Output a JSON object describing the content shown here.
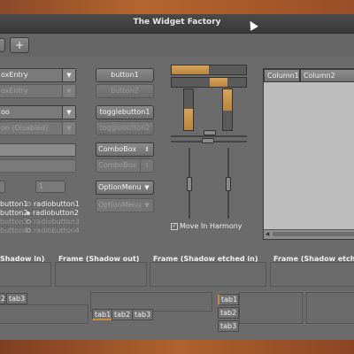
{
  "window": {
    "title": "The Widget Factory"
  },
  "toolbar": {
    "add_label": "+"
  },
  "col1": {
    "combo_entry": "oxEntry",
    "combo_entry_disabled": "oxEntry",
    "combo": "oo",
    "combo_disabled": "oo (Disabled)",
    "spin_value": "1",
    "radios_left": [
      "button1",
      "button2",
      "button3",
      "button4"
    ]
  },
  "col2": {
    "button1": "button1",
    "button2": "button2",
    "toggle1": "togglebutton1",
    "toggle2": "togglebutton2",
    "combobox": "ComboBox",
    "combobox_disabled": "ComboBox",
    "optionmenu": "OptionMenu",
    "optionmenu_disabled": "OptionMenu",
    "radios": [
      "radiobutton1",
      "radiobutton2",
      "radiobutton3",
      "radiobutton4"
    ]
  },
  "col3": {
    "check_label": "Move In Harmony"
  },
  "tree": {
    "columns": [
      "Column1",
      "Column2"
    ]
  },
  "frames": [
    "Shadow in)",
    "Frame (Shadow out)",
    "Frame (Shadow etched in)",
    "Frame (Shadow etche"
  ],
  "tabs_a": [
    "2",
    "tab3"
  ],
  "tabs_b": [
    "tab1",
    "tab2",
    "tab3"
  ],
  "tabs_c": [
    "tab1",
    "tab2",
    "tab3"
  ],
  "colors": {
    "accent": "#c88a3a",
    "window_bg": "#6b6b6b"
  }
}
